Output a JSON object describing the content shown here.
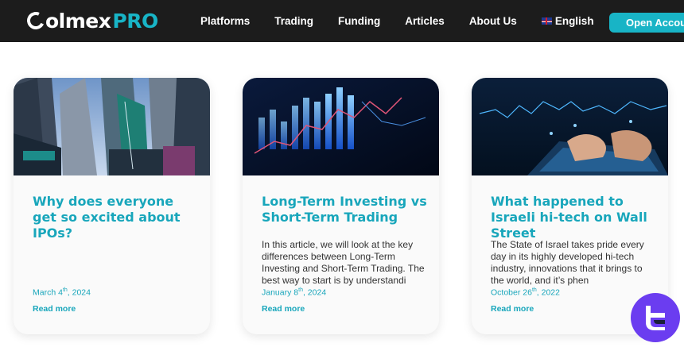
{
  "header": {
    "logo_main": "olmex",
    "logo_pro": "PRO",
    "nav": [
      "Platforms",
      "Trading",
      "Funding",
      "Articles",
      "About Us"
    ],
    "language": "English",
    "open_account": "Open Account"
  },
  "articles": [
    {
      "title": "Why does everyone get so excited about IPOs?",
      "excerpt": "",
      "date_pre": "March 4",
      "date_sup": "th",
      "date_post": ", 2024",
      "read_more": "Read more"
    },
    {
      "title": "Long-Term Investing vs Short-Term Trading",
      "excerpt": "In this article, we will look at the key differences between Long-Term Investing and Short-Term Trading. The best way to start is by understandi",
      "date_pre": "January 8",
      "date_sup": "th",
      "date_post": ", 2024",
      "read_more": "Read more"
    },
    {
      "title": "What happened to Israeli hi-tech on Wall Street",
      "excerpt": "The State of Israel takes pride every day in its highly developed hi-tech industry, innovations that it brings to the world, and it’s phen",
      "date_pre": "October 26",
      "date_sup": "th",
      "date_post": ", 2022",
      "read_more": "Read more"
    }
  ],
  "colors": {
    "accent": "#18b4c6",
    "header_bg": "#1c1c1c",
    "badge": "#6b3df0"
  }
}
